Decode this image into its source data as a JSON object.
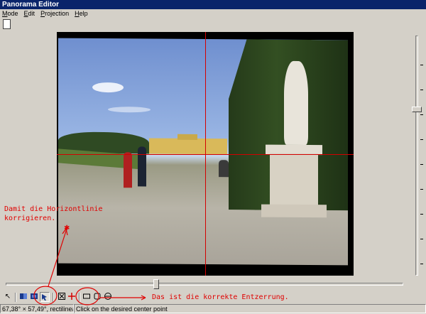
{
  "window": {
    "title": "Panorama Editor"
  },
  "menu": {
    "items": [
      "Mode",
      "Edit",
      "Projection",
      "Help"
    ]
  },
  "status": {
    "fov": "67,38° × 57,49°, rectilinear",
    "message": "Click on the desired center point"
  },
  "annotations": {
    "left_note_line1": "Damit die Horizontlinie",
    "left_note_line2": "korrigieren.",
    "right_note": "Das ist die korrekte Entzerrung."
  },
  "toolbar": {
    "icons": [
      "pointer-icon",
      "center-tool-icon",
      "straighten-tool-icon",
      "rotate-tool-icon",
      "zoom-fit-icon",
      "crosshair-icon",
      "rectilinear-icon",
      "fisheye-icon",
      "equirect-icon"
    ]
  },
  "colors": {
    "guide_lines": "#d30000",
    "annotation": "#e00000",
    "titlebar": "#0a246a"
  }
}
